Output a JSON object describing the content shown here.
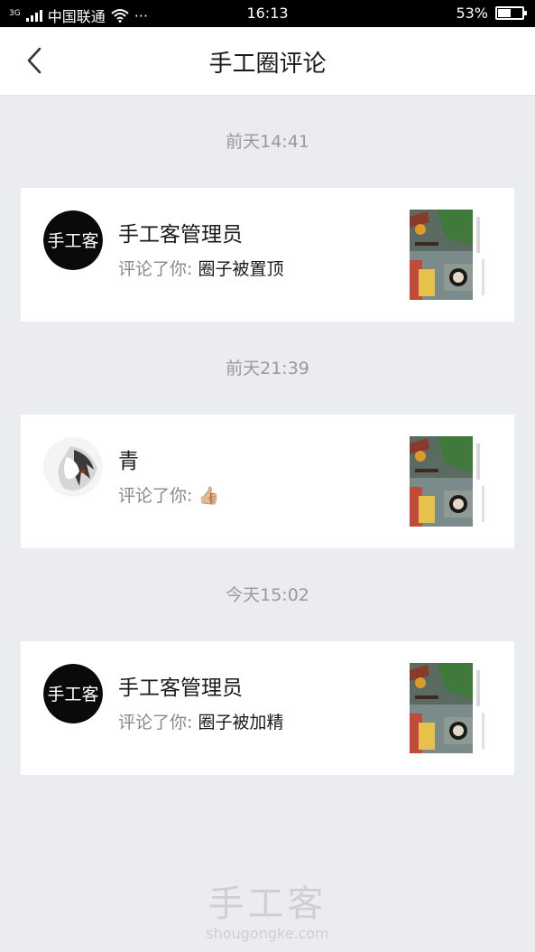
{
  "status_bar": {
    "signal_label": "3G",
    "carrier": "中国联通",
    "dots": "···",
    "time": "16:13",
    "battery_percent_text": "53%",
    "battery_level": 0.53
  },
  "nav": {
    "title": "手工圈评论",
    "back_icon": "chevron-left-icon"
  },
  "comments": [
    {
      "time": "前天14:41",
      "name": "手工客管理员",
      "prefix": "评论了你: ",
      "body": "圈子被置顶",
      "avatar_logo": "手工客"
    },
    {
      "time": "前天21:39",
      "name": "青",
      "prefix": "评论了你: ",
      "body": "👍🏼"
    },
    {
      "time": "今天15:02",
      "name": "手工客管理员",
      "prefix": "评论了你: ",
      "body": "圈子被加精",
      "avatar_logo": "手工客"
    }
  ],
  "watermark": {
    "title": "手工客",
    "url": "shougongke.com"
  },
  "colors": {
    "background": "#ebecf0",
    "card": "#ffffff",
    "muted_text": "#999999"
  }
}
